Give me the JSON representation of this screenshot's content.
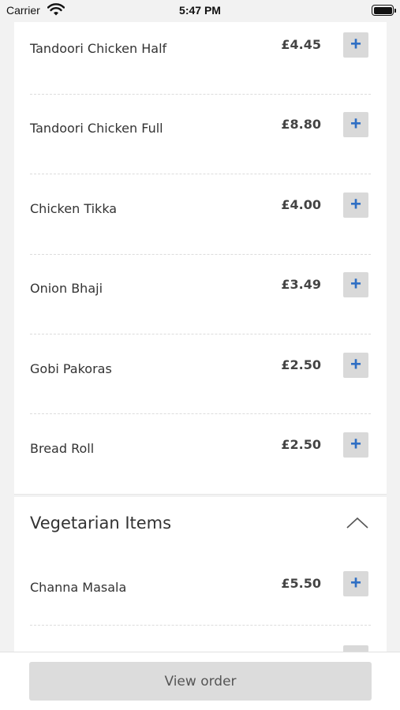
{
  "status_bar": {
    "carrier": "Carrier",
    "time": "5:47 PM"
  },
  "menu": {
    "items": [
      {
        "name": "Tandoori Chicken Half",
        "price": "£4.45"
      },
      {
        "name": "Tandoori Chicken Full",
        "price": "£8.80"
      },
      {
        "name": "Chicken Tikka",
        "price": "£4.00"
      },
      {
        "name": "Onion Bhaji",
        "price": "£3.49"
      },
      {
        "name": "Gobi Pakoras",
        "price": "£2.50"
      },
      {
        "name": "Bread Roll",
        "price": "£2.50"
      }
    ],
    "add_icon": "+"
  },
  "vegetarian": {
    "title": "Vegetarian Items",
    "items": [
      {
        "name": "Channa Masala",
        "price": "£5.50"
      }
    ]
  },
  "footer": {
    "view_order_label": "View order"
  },
  "colors": {
    "accent": "#2f6fc4",
    "button_bg": "#d9d9d9"
  }
}
